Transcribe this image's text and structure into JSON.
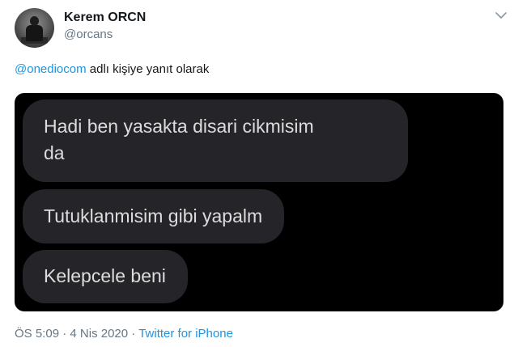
{
  "user": {
    "display_name": "Kerem ORCN",
    "handle": "@orcans"
  },
  "reply": {
    "mention": "@onediocom",
    "suffix": " adlı kişiye yanıt olarak"
  },
  "messages": [
    {
      "line1": "Hadi ben yasakta disari cikmisim",
      "line2": "da"
    },
    {
      "line1": "Tutuklanmisim gibi yapalm"
    },
    {
      "line1": "Kelepcele beni"
    }
  ],
  "meta": {
    "time": "ÖS 5:09",
    "separator": "·",
    "date": "4 Nis 2020",
    "source": "Twitter for iPhone"
  },
  "icons": {
    "menu": "chevron-down-icon"
  }
}
